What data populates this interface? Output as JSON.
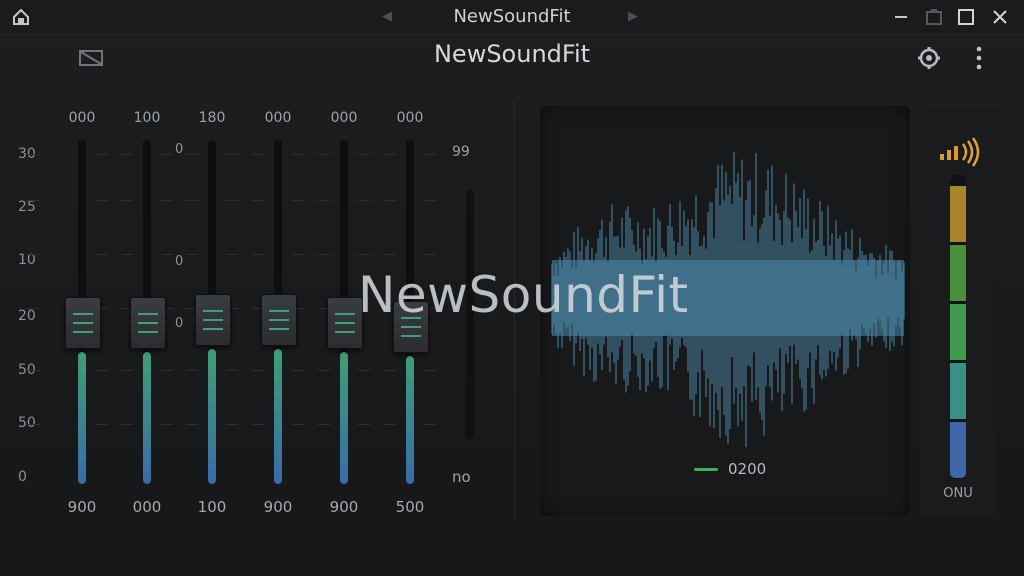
{
  "window": {
    "title": "NewSoundFit"
  },
  "header": {
    "title": "NewSoundFit"
  },
  "eq": {
    "scale": [
      "30",
      "25",
      "10",
      "20",
      "50",
      "50",
      "0"
    ],
    "mid_labels": [
      "0",
      "0",
      "0"
    ],
    "bands": [
      {
        "top": "000",
        "bottom": "900",
        "level": 0.47
      },
      {
        "top": "100",
        "bottom": "000",
        "level": 0.47
      },
      {
        "top": "180",
        "bottom": "100",
        "level": 0.48
      },
      {
        "top": "000",
        "bottom": "900",
        "level": 0.48
      },
      {
        "top": "000",
        "bottom": "900",
        "level": 0.47
      },
      {
        "top": "000",
        "bottom": "500",
        "level": 0.46
      }
    ],
    "side": {
      "top": "99",
      "bottom": "no"
    }
  },
  "waveform": {
    "legend": "0200",
    "legend_color": "#3fae5e",
    "wave_color": "#4d8bab"
  },
  "meter": {
    "label": "ONU",
    "segments": [
      "#3e67a8",
      "#3a8f86",
      "#3f9a4e",
      "#4a8f3a",
      "#a8852c"
    ]
  },
  "watermark": {
    "text": "NewSoundFit"
  }
}
